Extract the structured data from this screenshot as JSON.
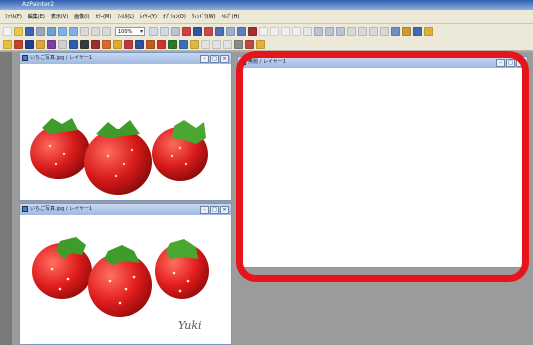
{
  "app": {
    "title": "AzPainter2"
  },
  "menu": [
    "ﾌｧｲﾙ(F)",
    "編集(E)",
    "表示(V)",
    "画像(I)",
    "ｶﾗｰ(M)",
    "ﾌｨﾙﾀ(L)",
    "ﾚｲﾔｰ(Y)",
    "ｵﾌﾟｼｮﾝ(O)",
    "ｳｨﾝﾄﾞｳ(W)",
    "ﾍﾙﾌﾟ(H)"
  ],
  "toolbar": {
    "zoom_value": "100%"
  },
  "windows": {
    "top_left": {
      "title": "いちご写真.jpg / レイヤー1"
    },
    "bottom_left": {
      "title": "いちご写真.jpg / レイヤー1"
    },
    "right": {
      "title": "無題 / レイヤー1"
    }
  },
  "signature": "Yuki",
  "colors": {
    "highlight": "#e8141b",
    "strawberry": "#d81f1f",
    "leaf": "#3f9c2a"
  }
}
